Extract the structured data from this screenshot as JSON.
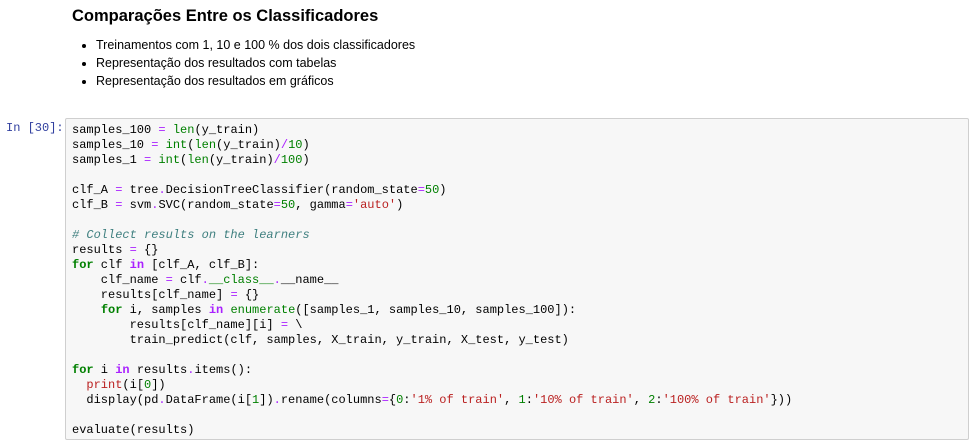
{
  "markdown": {
    "heading": "Comparações Entre os Classificadores",
    "bullets": [
      "Treinamentos com 1, 10 e 100 % dos dois classificadores",
      "Representação dos resultados com tabelas",
      "Representação dos resultados em gráficos"
    ]
  },
  "code_cell": {
    "prompt": "In [30]:",
    "lines": [
      [
        {
          "t": "samples_100 "
        },
        {
          "t": "=",
          "c": "op"
        },
        {
          "t": " "
        },
        {
          "t": "len",
          "c": "bi"
        },
        {
          "t": "(y_train)"
        }
      ],
      [
        {
          "t": "samples_10 "
        },
        {
          "t": "=",
          "c": "op"
        },
        {
          "t": " "
        },
        {
          "t": "int",
          "c": "bi"
        },
        {
          "t": "("
        },
        {
          "t": "len",
          "c": "bi"
        },
        {
          "t": "(y_train)"
        },
        {
          "t": "/",
          "c": "op"
        },
        {
          "t": "10",
          "c": "num"
        },
        {
          "t": ")"
        }
      ],
      [
        {
          "t": "samples_1 "
        },
        {
          "t": "=",
          "c": "op"
        },
        {
          "t": " "
        },
        {
          "t": "int",
          "c": "bi"
        },
        {
          "t": "("
        },
        {
          "t": "len",
          "c": "bi"
        },
        {
          "t": "(y_train)"
        },
        {
          "t": "/",
          "c": "op"
        },
        {
          "t": "100",
          "c": "num"
        },
        {
          "t": ")"
        }
      ],
      [],
      [
        {
          "t": "clf_A "
        },
        {
          "t": "=",
          "c": "op"
        },
        {
          "t": " tree"
        },
        {
          "t": ".",
          "c": "op"
        },
        {
          "t": "DecisionTreeClassifier(random_state"
        },
        {
          "t": "=",
          "c": "op"
        },
        {
          "t": "50",
          "c": "num"
        },
        {
          "t": ")"
        }
      ],
      [
        {
          "t": "clf_B "
        },
        {
          "t": "=",
          "c": "op"
        },
        {
          "t": " svm"
        },
        {
          "t": ".",
          "c": "op"
        },
        {
          "t": "SVC(random_state"
        },
        {
          "t": "=",
          "c": "op"
        },
        {
          "t": "50",
          "c": "num"
        },
        {
          "t": ", gamma"
        },
        {
          "t": "=",
          "c": "op"
        },
        {
          "t": "'auto'",
          "c": "str"
        },
        {
          "t": ")"
        }
      ],
      [],
      [
        {
          "t": "# Collect results on the learners",
          "c": "cm"
        }
      ],
      [
        {
          "t": "results "
        },
        {
          "t": "=",
          "c": "op"
        },
        {
          "t": " {}"
        }
      ],
      [
        {
          "t": "for",
          "c": "kw"
        },
        {
          "t": " clf "
        },
        {
          "t": "in",
          "c": "opw"
        },
        {
          "t": " [clf_A, clf_B]:"
        }
      ],
      [
        {
          "t": "    clf_name "
        },
        {
          "t": "=",
          "c": "op"
        },
        {
          "t": " clf"
        },
        {
          "t": ".",
          "c": "op"
        },
        {
          "t": "__class__",
          "c": "bi"
        },
        {
          "t": ".",
          "c": "op"
        },
        {
          "t": "__name__"
        }
      ],
      [
        {
          "t": "    results[clf_name] "
        },
        {
          "t": "=",
          "c": "op"
        },
        {
          "t": " {}"
        }
      ],
      [
        {
          "t": "    "
        },
        {
          "t": "for",
          "c": "kw"
        },
        {
          "t": " i, samples "
        },
        {
          "t": "in",
          "c": "opw"
        },
        {
          "t": " "
        },
        {
          "t": "enumerate",
          "c": "bi"
        },
        {
          "t": "([samples_1, samples_10, samples_100]):"
        }
      ],
      [
        {
          "t": "        results[clf_name][i] "
        },
        {
          "t": "=",
          "c": "op"
        },
        {
          "t": " \\"
        }
      ],
      [
        {
          "t": "        train_predict(clf, samples, X_train, y_train, X_test, y_test)"
        }
      ],
      [],
      [
        {
          "t": "for",
          "c": "kw"
        },
        {
          "t": " i "
        },
        {
          "t": "in",
          "c": "opw"
        },
        {
          "t": " results"
        },
        {
          "t": ".",
          "c": "op"
        },
        {
          "t": "items():"
        }
      ],
      [
        {
          "t": "  "
        },
        {
          "t": "print",
          "c": "str"
        },
        {
          "t": "(i["
        },
        {
          "t": "0",
          "c": "num"
        },
        {
          "t": "])"
        }
      ],
      [
        {
          "t": "  display(pd"
        },
        {
          "t": ".",
          "c": "op"
        },
        {
          "t": "DataFrame(i["
        },
        {
          "t": "1",
          "c": "num"
        },
        {
          "t": "])"
        },
        {
          "t": ".",
          "c": "op"
        },
        {
          "t": "rename(columns"
        },
        {
          "t": "=",
          "c": "op"
        },
        {
          "t": "{"
        },
        {
          "t": "0",
          "c": "num"
        },
        {
          "t": ":"
        },
        {
          "t": "'1% of train'",
          "c": "str"
        },
        {
          "t": ", "
        },
        {
          "t": "1",
          "c": "num"
        },
        {
          "t": ":"
        },
        {
          "t": "'10% of train'",
          "c": "str"
        },
        {
          "t": ", "
        },
        {
          "t": "2",
          "c": "num"
        },
        {
          "t": ":"
        },
        {
          "t": "'100% of train'",
          "c": "str"
        },
        {
          "t": "}))"
        }
      ],
      [],
      [
        {
          "t": "evaluate(results)"
        }
      ]
    ]
  }
}
